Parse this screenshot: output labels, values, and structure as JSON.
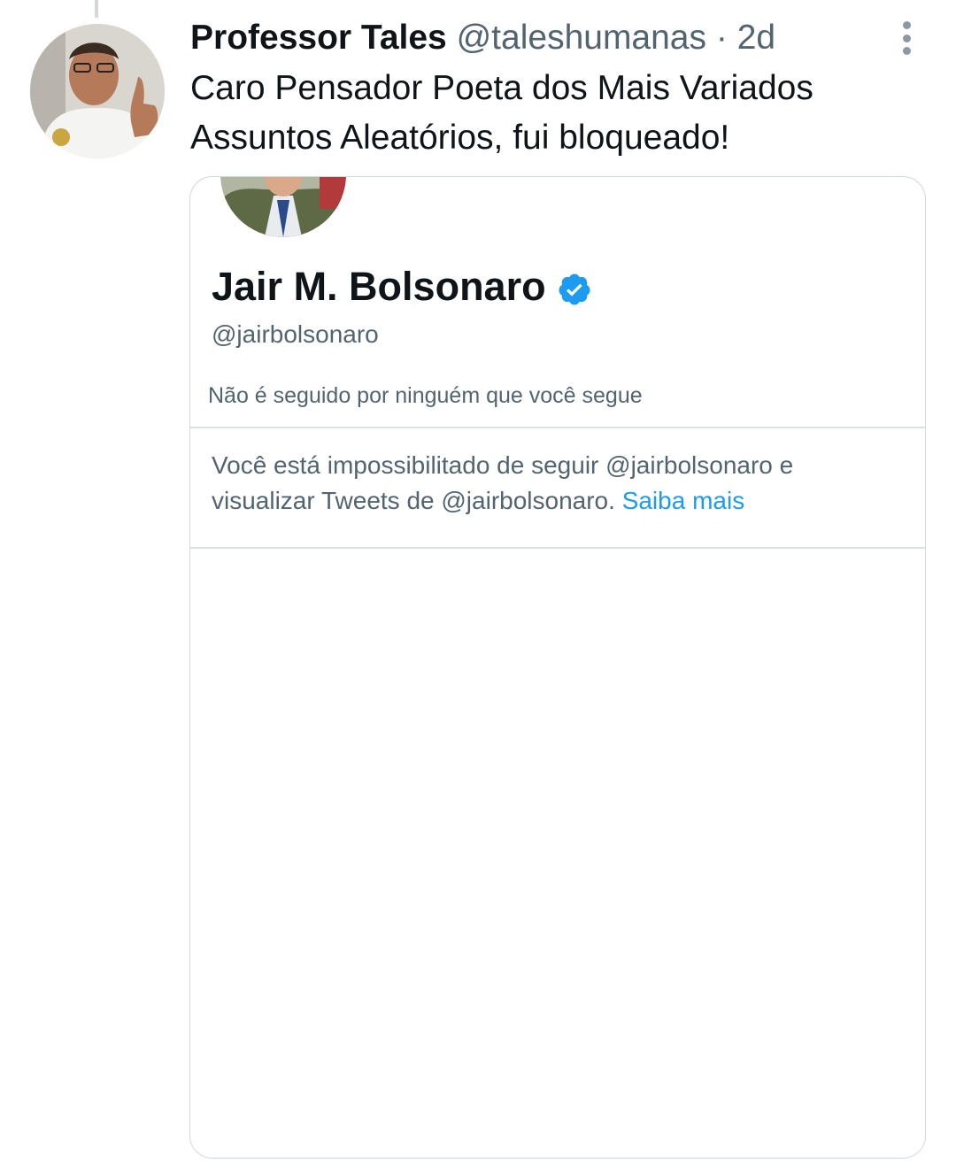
{
  "tweet": {
    "author_name": "Professor Tales",
    "author_handle": "@taleshumanas",
    "separator": "·",
    "time": "2d",
    "text": "Caro Pensador Poeta dos Mais Variados Assuntos Aleatórios, fui bloqueado!",
    "more_icon": "more-vertical-icon"
  },
  "card": {
    "profile_name": "Jair M. Bolsonaro",
    "profile_handle": "@jairbolsonaro",
    "verified_icon": "verified-badge-icon",
    "follow_context": "Não é seguido por ninguém que você segue",
    "blocked_message": "Você está impossibilitado de seguir @jairbolsonaro e visualizar Tweets de @jairbolsonaro.",
    "learn_more": "Saiba mais"
  },
  "colors": {
    "accent": "#1d9bf0",
    "secondary_text": "#536471",
    "primary_text": "#0f1419",
    "border": "#cfd9de"
  }
}
